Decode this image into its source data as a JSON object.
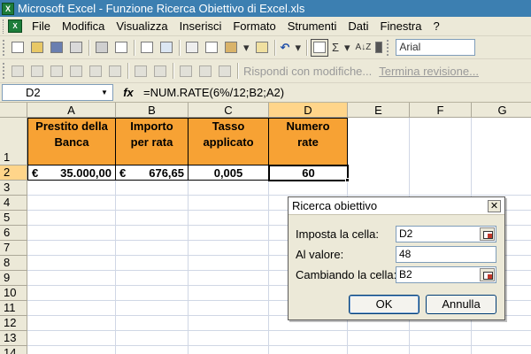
{
  "window": {
    "title": "Microsoft Excel - Funzione Ricerca Obiettivo di Excel.xls",
    "app_icon_text": "X"
  },
  "menu": {
    "items": [
      "File",
      "Modifica",
      "Visualizza",
      "Inserisci",
      "Formato",
      "Strumenti",
      "Dati",
      "Finestra",
      "?"
    ]
  },
  "toolbar": {
    "sigma": "Σ",
    "undo": "↶",
    "font_name": "Arial",
    "reply_label": "Rispondi con modifiche...",
    "end_review_label": "Termina revisione..."
  },
  "formula_bar": {
    "name_box": "D2",
    "fx": "fx",
    "formula": "=NUM.RATE(6%/12;B2;A2)"
  },
  "sheet": {
    "columns": [
      "A",
      "B",
      "C",
      "D",
      "E",
      "F",
      "G"
    ],
    "rows": [
      "1",
      "2",
      "3",
      "4",
      "5",
      "6",
      "7",
      "8",
      "9",
      "10",
      "11",
      "12",
      "13",
      "14"
    ],
    "header_cells": [
      {
        "line1": "Prestito della",
        "line2": "Banca"
      },
      {
        "line1": "Importo",
        "line2": "per rata"
      },
      {
        "line1": "Tasso",
        "line2": "applicato"
      },
      {
        "line1": "Numero",
        "line2": "rate"
      }
    ],
    "data_row": {
      "a_currency": "€",
      "a_value": "35.000,00",
      "b_currency": "€",
      "b_value": "676,65",
      "c_value": "0,005",
      "d_value": "60"
    },
    "selected_cell": "D2",
    "header_fill": "#f7a234"
  },
  "dialog": {
    "title": "Ricerca obiettivo",
    "close": "✕",
    "set_cell_label": "Imposta la cella:",
    "set_cell_value": "D2",
    "to_value_label": "Al valore:",
    "to_value_value": "48",
    "by_changing_label": "Cambiando la cella:",
    "by_changing_value": "B2",
    "ok_label": "OK",
    "cancel_label": "Annulla"
  }
}
